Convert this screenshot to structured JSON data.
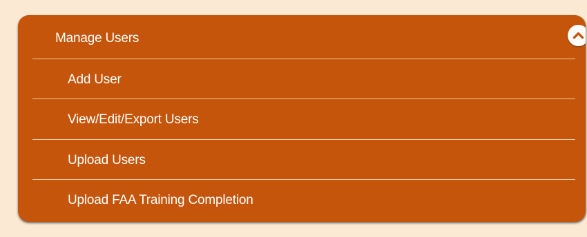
{
  "menu": {
    "title": "Manage Users",
    "toggle_icon": "chevron-up-icon",
    "items": [
      {
        "label": "Add User"
      },
      {
        "label": "View/Edit/Export Users"
      },
      {
        "label": "Upload Users"
      },
      {
        "label": "Upload FAA Training Completion"
      }
    ]
  },
  "colors": {
    "page_background": "#fbe9d4",
    "panel_background": "#c5550a",
    "text": "#ffffff",
    "divider": "#ffe2c4",
    "toggle_background": "#ffffff"
  }
}
